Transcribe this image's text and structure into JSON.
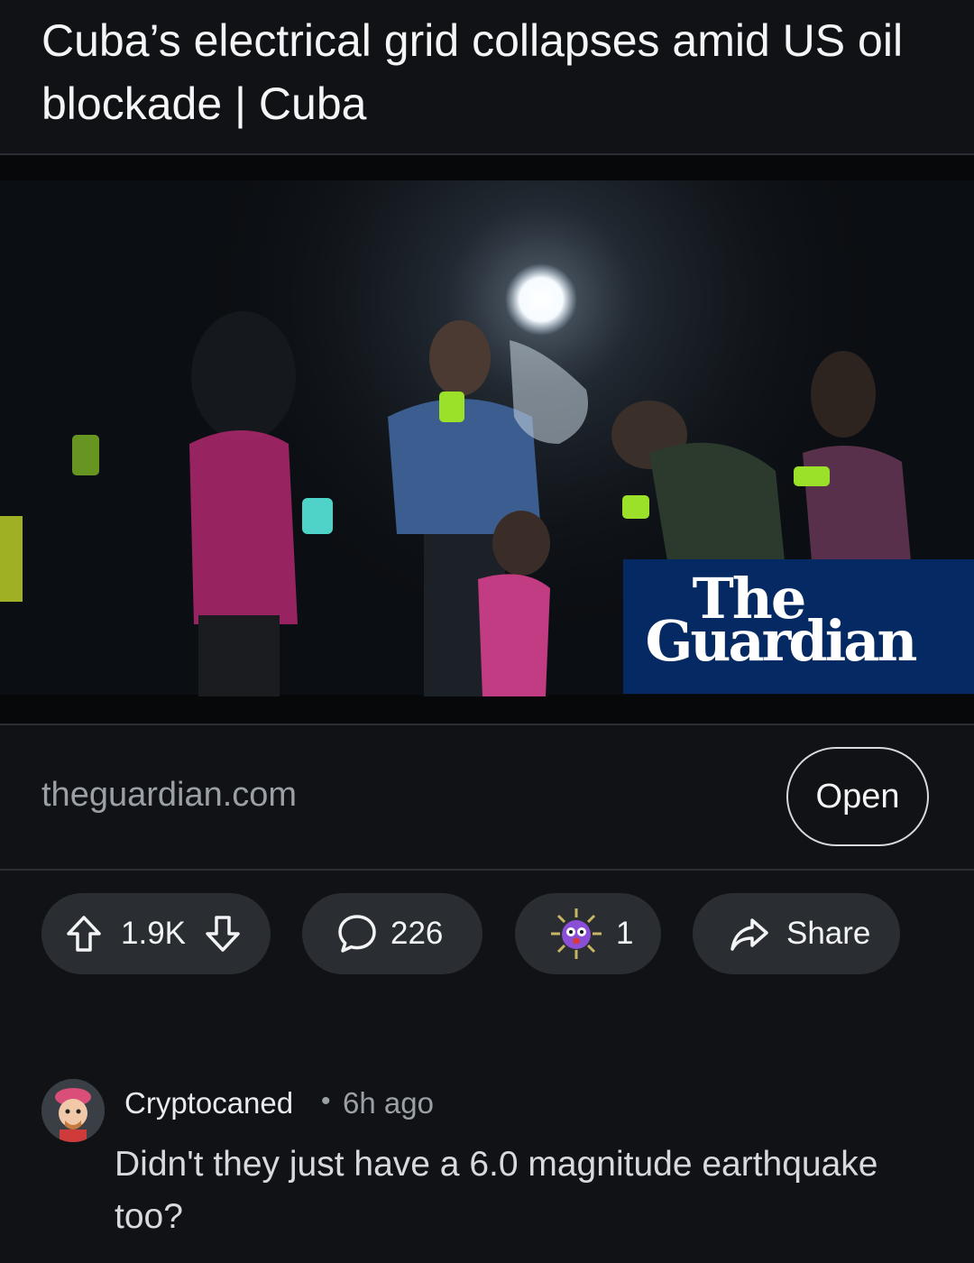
{
  "post": {
    "title": "Cuba’s electrical grid collapses amid US oil blockade | Cuba"
  },
  "link": {
    "watermark_logo": "The Guardian",
    "domain": "theguardian.com",
    "open_label": "Open"
  },
  "actions": {
    "upvotes": "1.9K",
    "comments": "226",
    "awards": "1",
    "share_label": "Share"
  },
  "comment": {
    "author": "Cryptocaned",
    "separator": "•",
    "time": "6h ago",
    "body": "Didn't they just have a 6.0 magnitude earthquake too?"
  },
  "colors": {
    "background": "#101215",
    "pill": "#2a2d31",
    "guardian_blue": "#052962"
  }
}
